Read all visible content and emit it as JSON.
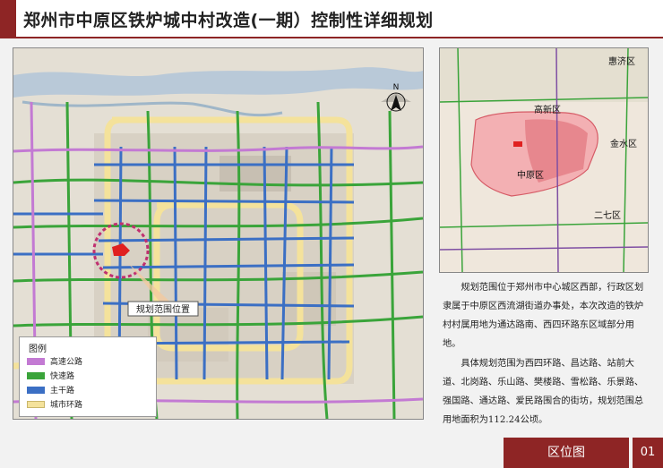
{
  "header": {
    "title": "郑州市中原区铁炉城中村改造(一期）控制性详细规划"
  },
  "main_map": {
    "north_label": "N",
    "site_label": "规划范围位置",
    "legend": {
      "title": "图例",
      "items": [
        {
          "label": "高速公路",
          "color": "#c37ad3"
        },
        {
          "label": "快速路",
          "color": "#3aa43a"
        },
        {
          "label": "主干路",
          "color": "#3b6fc4"
        },
        {
          "label": "城市环路",
          "color": "#f4e29b"
        }
      ]
    }
  },
  "inset_map": {
    "districts": [
      "惠济区",
      "高新区",
      "金水区",
      "中原区",
      "二七区"
    ]
  },
  "description": {
    "paragraphs": [
      "规划范围位于郑州市中心城区西部，行政区划隶属于中原区西流湖街道办事处，本次改造的铁炉村村属用地为通达路南、西四环路东区域部分用地。",
      "具体规划范围为西四环路、昌达路、站前大道、北岗路、乐山路、樊楼路、雪松路、乐景路、强国路、通达路、爱民路围合的街坊，规划范围总用地面积为112.24公顷。"
    ]
  },
  "footer": {
    "tab_label": "区位图",
    "page_number": "01"
  },
  "colors": {
    "brand": "#8e2525",
    "highway": "#c37ad3",
    "expressway": "#3aa43a",
    "arterial": "#3b6fc4",
    "ring": "#f4e29b",
    "site": "#e02020"
  }
}
